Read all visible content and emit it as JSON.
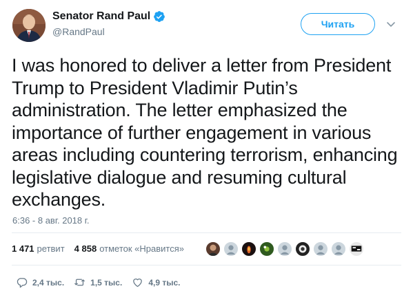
{
  "author": {
    "display_name": "Senator Rand Paul",
    "handle": "@RandPaul",
    "verified": true
  },
  "follow_button": {
    "label": "Читать"
  },
  "tweet": {
    "text": "I was honored to deliver a letter from President Trump to President Vladimir Putin’s administration. The letter emphasized the importance of further engagement in various areas including countering terrorism, enhancing legislative dialogue and resuming cultural exchanges.",
    "timestamp": "6:36 - 8 авг. 2018 г."
  },
  "stats": {
    "retweets_count": "1 471",
    "retweets_label": "ретвит",
    "likes_count": "4 858",
    "likes_label": "отметок «Нравится»"
  },
  "actions": {
    "replies": "2,4 тыс.",
    "retweets": "1,5 тыс.",
    "likes": "4,9 тыс."
  },
  "colors": {
    "accent": "#1da1f2",
    "text": "#14171a",
    "secondary": "#657786",
    "divider": "#e6ecf0"
  }
}
